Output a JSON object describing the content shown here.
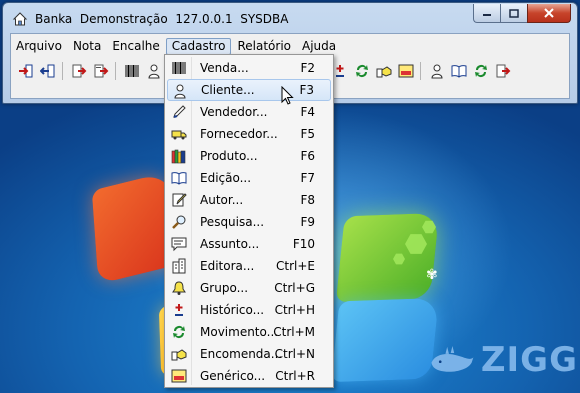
{
  "window": {
    "title": "Banka  Demonstração  127.0.0.1  SYSDBA",
    "app_icon": "home-icon",
    "buttons": {
      "minimize": "minimize-icon",
      "maximize": "maximize-icon",
      "close": "close-icon"
    }
  },
  "menubar": {
    "items": [
      {
        "label": "Arquivo"
      },
      {
        "label": "Nota"
      },
      {
        "label": "Encalhe"
      },
      {
        "label": "Cadastro"
      },
      {
        "label": "Relatório"
      },
      {
        "label": "Ajuda"
      }
    ],
    "active": "Cadastro"
  },
  "toolbar": {
    "icons": [
      "login-icon",
      "logout-icon",
      "document-export-icon",
      "document-import-icon",
      "barcode-icon",
      "person-icon",
      "building-icon",
      "bell-icon",
      "plus-minus-icon",
      "refresh-icon",
      "handshake-icon",
      "gradient-icon",
      "person-icon",
      "book-icon",
      "refresh-icon",
      "document-export-icon"
    ]
  },
  "dropdown": {
    "items": [
      {
        "label": "Venda...",
        "shortcut": "F2",
        "icon": "barcode-icon"
      },
      {
        "label": "Cliente...",
        "shortcut": "F3",
        "icon": "person-icon"
      },
      {
        "label": "Vendedor...",
        "shortcut": "F4",
        "icon": "pen-icon"
      },
      {
        "label": "Fornecedor...",
        "shortcut": "F5",
        "icon": "truck-icon"
      },
      {
        "label": "Produto...",
        "shortcut": "F6",
        "icon": "books-icon"
      },
      {
        "label": "Edição...",
        "shortcut": "F7",
        "icon": "book-icon"
      },
      {
        "label": "Autor...",
        "shortcut": "F8",
        "icon": "pencil-doc-icon"
      },
      {
        "label": "Pesquisa...",
        "shortcut": "F9",
        "icon": "magnifier-icon"
      },
      {
        "label": "Assunto...",
        "shortcut": "F10",
        "icon": "speech-bubble-icon"
      },
      {
        "label": "Editora...",
        "shortcut": "Ctrl+E",
        "icon": "building-icon"
      },
      {
        "label": "Grupo...",
        "shortcut": "Ctrl+G",
        "icon": "bell-icon"
      },
      {
        "label": "Histórico...",
        "shortcut": "Ctrl+H",
        "icon": "plus-minus-icon"
      },
      {
        "label": "Movimento...",
        "shortcut": "Ctrl+M",
        "icon": "refresh-icon"
      },
      {
        "label": "Encomenda...",
        "shortcut": "Ctrl+N",
        "icon": "handshake-icon"
      },
      {
        "label": "Genérico...",
        "shortcut": "Ctrl+R",
        "icon": "gradient-icon"
      }
    ],
    "hover_index": 1
  },
  "watermark": {
    "text": "ZIGG"
  },
  "colors": {
    "accent": "#3b5a82",
    "menu_hover": "#d5e6f8",
    "close_red": "#c7442b"
  }
}
